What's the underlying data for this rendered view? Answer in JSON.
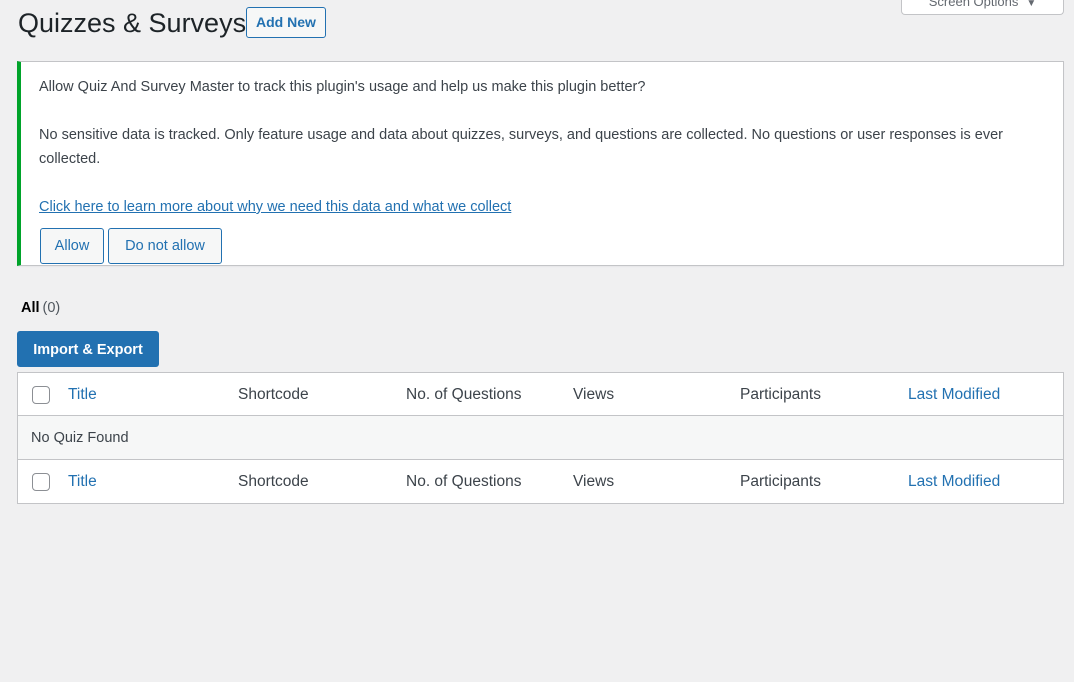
{
  "screen_options": {
    "label": "Screen Options"
  },
  "header": {
    "title": "Quizzes & Surveys",
    "add_new_label": "Add New"
  },
  "notice": {
    "question": "Allow Quiz And Survey Master to track this plugin's usage and help us make this plugin better?",
    "description": "No sensitive data is tracked. Only feature usage and data about quizzes, surveys, and questions are collected. No questions or user responses is ever collected.",
    "learn_more_link": "Click here to learn more about why we need this data and what we collect",
    "allow_label": "Allow",
    "disallow_label": "Do not allow",
    "accent_color": "#00a32a"
  },
  "filters": {
    "all_label": "All",
    "all_count": "(0)"
  },
  "import_export_label": "Import & Export",
  "table": {
    "columns": {
      "title": "Title",
      "shortcode": "Shortcode",
      "questions": "No. of Questions",
      "views": "Views",
      "participants": "Participants",
      "last_modified": "Last Modified"
    },
    "empty_message": "No Quiz Found"
  },
  "colors": {
    "primary": "#2271b1",
    "background": "#f0f0f1"
  }
}
